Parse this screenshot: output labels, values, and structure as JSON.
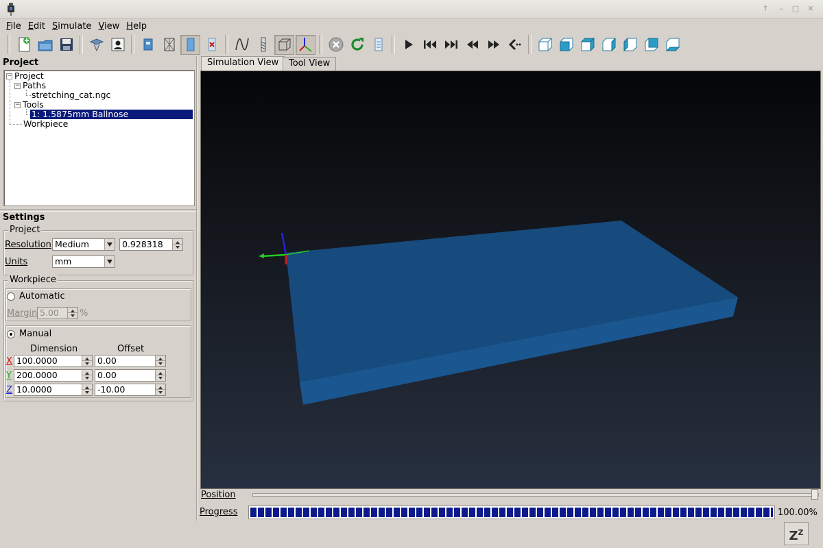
{
  "menu": [
    {
      "label": "File",
      "mnemonic": "F",
      "rest": "ile"
    },
    {
      "label": "Edit",
      "mnemonic": "E",
      "rest": "dit"
    },
    {
      "label": "Simulate",
      "mnemonic": "S",
      "rest": "imulate"
    },
    {
      "label": "View",
      "mnemonic": "V",
      "rest": "iew"
    },
    {
      "label": "Help",
      "mnemonic": "H",
      "rest": "elp"
    }
  ],
  "project_panel": {
    "title": "Project",
    "tree": {
      "root": "Project",
      "paths": "Paths",
      "path_file": "stretching_cat.ngc",
      "tools": "Tools",
      "tool_item": "1: 1.5875mm Ballnose",
      "workpiece": "Workpiece"
    }
  },
  "settings": {
    "title": "Settings",
    "project_group": "Project",
    "resolution_label": "Resolution",
    "resolution_value": "Medium",
    "resolution_number": "0.928318",
    "units_label": "Units",
    "units_value": "mm",
    "workpiece_group": "Workpiece",
    "automatic_label": "Automatic",
    "margin_label": "Margin",
    "margin_value": "5.00",
    "margin_unit": "%",
    "manual_label": "Manual",
    "dimension_header": "Dimension",
    "offset_header": "Offset",
    "x_label": "X",
    "y_label": "Y",
    "z_label": "Z",
    "x_dimension": "100.0000",
    "y_dimension": "200.0000",
    "z_dimension": "10.0000",
    "x_offset": "0.00",
    "y_offset": "0.00",
    "z_offset": "-10.00"
  },
  "tabs": {
    "simulation": "Simulation View",
    "tool": "Tool View"
  },
  "position_label": "Position",
  "progress_label": "Progress",
  "progress_value": 100,
  "progress_text": "100.00%",
  "sleep_label": "Z",
  "colors": {
    "selection": "#0a1a7a",
    "workpiece": "#174a7d",
    "progress": "#0c1a8c",
    "axis_x": "#d11616",
    "axis_y": "#22cc22",
    "axis_z": "#2222dd"
  }
}
